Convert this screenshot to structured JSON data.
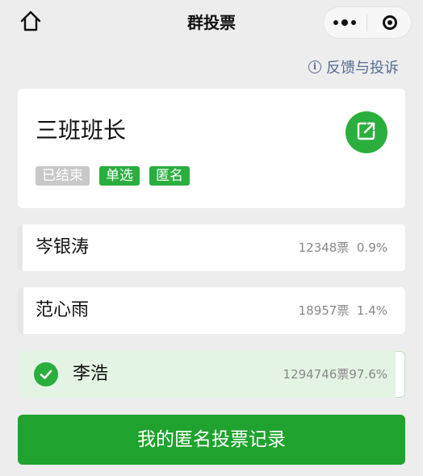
{
  "navbar": {
    "title": "群投票"
  },
  "feedback": {
    "label": "反馈与投诉"
  },
  "vote": {
    "title": "三班班长",
    "tags": [
      "已结束",
      "单选",
      "匿名"
    ]
  },
  "options": [
    {
      "name": "岑银涛",
      "votes": "12348票",
      "percent": "0.9%",
      "share": 0.009,
      "selected": false
    },
    {
      "name": "范心雨",
      "votes": "18957票",
      "percent": "1.4%",
      "share": 0.014,
      "selected": false
    },
    {
      "name": "李浩",
      "votes": "1294746票",
      "percent": "97.6%",
      "share": 0.976,
      "selected": true
    }
  ],
  "footer": {
    "button_label": "我的匿名投票记录"
  },
  "colors": {
    "brand_green": "#1fa32e",
    "link_blue": "#576b95",
    "selected_bg": "#e3f4e5"
  },
  "icons": {
    "home": "home-icon",
    "more": "more-icon",
    "close": "close-miniprogram-icon",
    "info": "info-icon",
    "share": "share-icon",
    "check": "check-icon"
  }
}
